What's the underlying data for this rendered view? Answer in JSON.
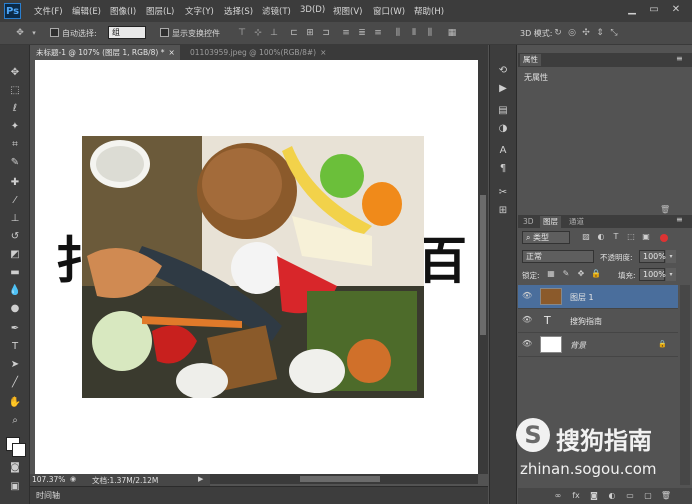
{
  "app": {
    "logo": "Ps"
  },
  "menu": [
    "文件(F)",
    "编辑(E)",
    "图像(I)",
    "图层(L)",
    "文字(Y)",
    "选择(S)",
    "滤镜(T)",
    "3D(D)",
    "视图(V)",
    "窗口(W)",
    "帮助(H)"
  ],
  "options": {
    "auto_select_label": "自动选择:",
    "auto_select_value": "组",
    "show_transform_label": "显示变换控件",
    "mode_3d_label": "3D 模式:"
  },
  "tabs": [
    {
      "label": "未标题-1 @ 107% (图层 1, RGB/8) *",
      "active": true
    },
    {
      "label": "01103959.jpeg @ 100%(RGB/8#)",
      "active": false
    }
  ],
  "canvas_text": {
    "left_glyph": "扌",
    "right_glyph": "百"
  },
  "status": {
    "zoom": "107.37%",
    "doc": "文档:1.37M/2.12M"
  },
  "timeline": {
    "label": "时间轴"
  },
  "properties": {
    "tab": "属性",
    "content": "无属性"
  },
  "layers_panel": {
    "tabs": [
      "3D",
      "图层",
      "通道"
    ],
    "filter_value": "类型",
    "blend_mode": "正常",
    "opacity_label": "不透明度:",
    "opacity_value": "100%",
    "lock_label": "锁定:",
    "fill_label": "填充:",
    "fill_value": "100%",
    "layers": [
      {
        "name": "图层 1",
        "type": "image",
        "selected": true
      },
      {
        "name": "搜狗指南",
        "type": "text",
        "selected": false
      },
      {
        "name": "背景",
        "type": "background",
        "selected": false
      }
    ]
  },
  "watermark": {
    "brand": "搜狗指南",
    "url": "zhinan.sogou.com"
  },
  "colors": {
    "accent": "#4a6e9c",
    "menubar": "#3c3c3c",
    "panel": "#535353"
  }
}
